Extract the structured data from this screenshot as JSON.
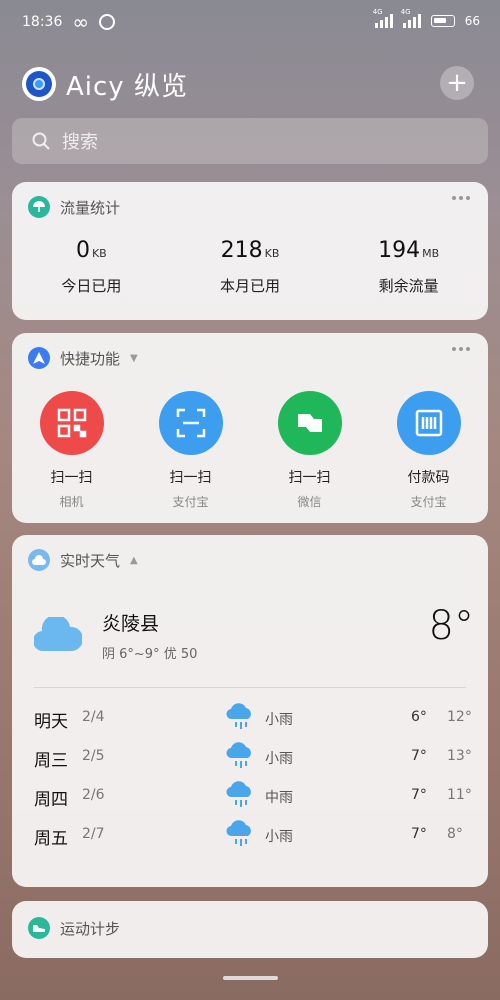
{
  "status": {
    "time": "18:36",
    "sig1": "4G",
    "sig2": "4G",
    "battery": "66"
  },
  "header": {
    "title": "Aicy 纵览",
    "add": "+"
  },
  "search": {
    "placeholder": "搜索"
  },
  "traffic": {
    "title": "流量统计",
    "stats": [
      {
        "value": "0",
        "unit": "KB",
        "label": "今日已用"
      },
      {
        "value": "218",
        "unit": "KB",
        "label": "本月已用"
      },
      {
        "value": "194",
        "unit": "MB",
        "label": "剩余流量"
      }
    ]
  },
  "quick": {
    "title": "快捷功能",
    "items": [
      {
        "label": "扫一扫",
        "sub": "相机",
        "color": "#ee4a4a"
      },
      {
        "label": "扫一扫",
        "sub": "支付宝",
        "color": "#3d9ef0"
      },
      {
        "label": "扫一扫",
        "sub": "微信",
        "color": "#20b75a"
      },
      {
        "label": "付款码",
        "sub": "支付宝",
        "color": "#3d9ef0"
      }
    ]
  },
  "weather": {
    "title": "实时天气",
    "city": "炎陵县",
    "summary": "阴  6°~9°  优 50",
    "temp": "8°",
    "forecast": [
      {
        "day": "明天",
        "date": "2/4",
        "cond": "小雨",
        "low": "6°",
        "high": "12°"
      },
      {
        "day": "周三",
        "date": "2/5",
        "cond": "小雨",
        "low": "7°",
        "high": "13°"
      },
      {
        "day": "周四",
        "date": "2/6",
        "cond": "中雨",
        "low": "7°",
        "high": "11°"
      },
      {
        "day": "周五",
        "date": "2/7",
        "cond": "小雨",
        "low": "7°",
        "high": "8°"
      }
    ]
  },
  "steps": {
    "title": "运动计步"
  }
}
